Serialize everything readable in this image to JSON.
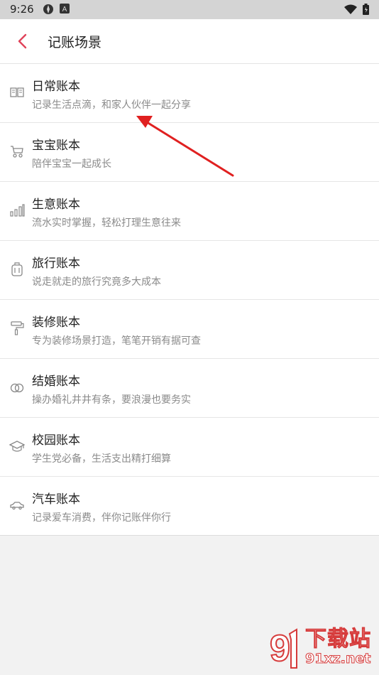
{
  "status_bar": {
    "time": "9:26",
    "icons": [
      "vpn-icon",
      "a-notification-icon",
      "wifi-icon",
      "battery-icon"
    ]
  },
  "app_bar": {
    "title": "记账场景",
    "back_icon": "chevron-left-icon",
    "accent": "#e0445a"
  },
  "scenes": [
    {
      "title": "日常账本",
      "subtitle": "记录生活点滴，和家人伙伴一起分享",
      "icon": "book-icon"
    },
    {
      "title": "宝宝账本",
      "subtitle": "陪伴宝宝一起成长",
      "icon": "stroller-icon"
    },
    {
      "title": "生意账本",
      "subtitle": "流水实时掌握，轻松打理生意往来",
      "icon": "bar-chart-icon"
    },
    {
      "title": "旅行账本",
      "subtitle": "说走就走的旅行究竟多大成本",
      "icon": "luggage-icon"
    },
    {
      "title": "装修账本",
      "subtitle": "专为装修场景打造，笔笔开销有据可查",
      "icon": "paint-roller-icon"
    },
    {
      "title": "结婚账本",
      "subtitle": "操办婚礼井井有条，要浪漫也要务实",
      "icon": "rings-icon"
    },
    {
      "title": "校园账本",
      "subtitle": "学生党必备，生活支出精打细算",
      "icon": "graduation-cap-icon"
    },
    {
      "title": "汽车账本",
      "subtitle": "记录爱车消费，伴你记账伴你行",
      "icon": "car-icon"
    }
  ],
  "annotation": {
    "color": "#e02020"
  },
  "watermark": {
    "top_text": "下载站",
    "bottom_text": "91xz.net",
    "color": "#d63b3b"
  }
}
